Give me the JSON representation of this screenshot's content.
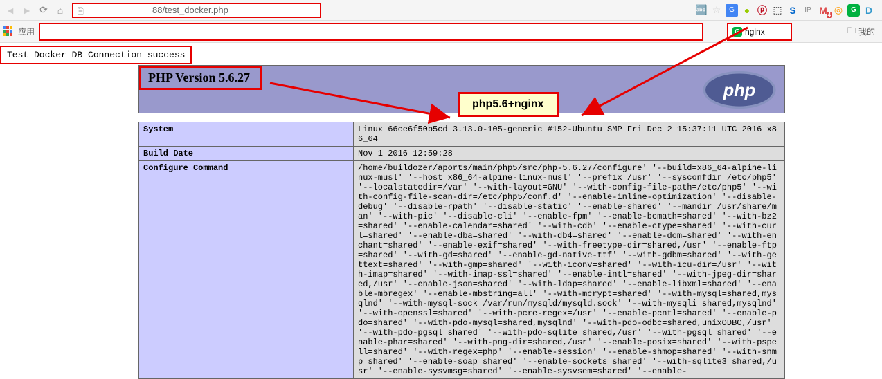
{
  "browser": {
    "url_visible": "88/test_docker.php",
    "apps_label": "应用",
    "other_bookmarks": "我的",
    "toolbar_icons": [
      "translate-icon",
      "star-icon",
      "google-icon",
      "green-dot-icon",
      "pinterest-icon",
      "extension-icon",
      "s-icon",
      "ip-icon",
      "gmail-icon",
      "gmail-badge-4",
      "circle-icon",
      "g-green-icon",
      "d-icon"
    ]
  },
  "callouts": {
    "nginx_label": "nginx",
    "success_message": "Test Docker DB Connection success",
    "annotation": "php5.6+nginx"
  },
  "phpinfo": {
    "version": "PHP Version 5.6.27",
    "rows": [
      {
        "label": "System",
        "value": "Linux 66ce6f50b5cd 3.13.0-105-generic #152-Ubuntu SMP Fri Dec 2 15:37:11 UTC 2016 x86_64"
      },
      {
        "label": "Build Date",
        "value": "Nov 1 2016 12:59:28"
      },
      {
        "label": "Configure Command",
        "value": "/home/buildozer/aports/main/php5/src/php-5.6.27/configure' '--build=x86_64-alpine-linux-musl' '--host=x86_64-alpine-linux-musl' '--prefix=/usr' '--sysconfdir=/etc/php5' '--localstatedir=/var' '--with-layout=GNU' '--with-config-file-path=/etc/php5' '--with-config-file-scan-dir=/etc/php5/conf.d' '--enable-inline-optimization' '--disable-debug' '--disable-rpath' '--disable-static' '--enable-shared' '--mandir=/usr/share/man' '--with-pic' '--disable-cli' '--enable-fpm' '--enable-bcmath=shared' '--with-bz2=shared' '--enable-calendar=shared' '--with-cdb' '--enable-ctype=shared' '--with-curl=shared' '--enable-dba=shared' '--with-db4=shared' '--enable-dom=shared' '--with-enchant=shared' '--enable-exif=shared' '--with-freetype-dir=shared,/usr' '--enable-ftp=shared' '--with-gd=shared' '--enable-gd-native-ttf' '--with-gdbm=shared' '--with-gettext=shared' '--with-gmp=shared' '--with-iconv=shared' '--with-icu-dir=/usr' '--with-imap=shared' '--with-imap-ssl=shared' '--enable-intl=shared' '--with-jpeg-dir=shared,/usr' '--enable-json=shared' '--with-ldap=shared' '--enable-libxml=shared' '--enable-mbregex' '--enable-mbstring=all' '--with-mcrypt=shared' '--with-mysql=shared,mysqlnd' '--with-mysql-sock=/var/run/mysqld/mysqld.sock' '--with-mysqli=shared,mysqlnd' '--with-openssl=shared' '--with-pcre-regex=/usr' '--enable-pcntl=shared' '--enable-pdo=shared' '--with-pdo-mysql=shared,mysqlnd' '--with-pdo-odbc=shared,unixODBC,/usr' '--with-pdo-pgsql=shared' '--with-pdo-sqlite=shared,/usr' '--with-pgsql=shared' '--enable-phar=shared' '--with-png-dir=shared,/usr' '--enable-posix=shared' '--with-pspell=shared' '--with-regex=php' '--enable-session' '--enable-shmop=shared' '--with-snmp=shared' '--enable-soap=shared' '--enable-sockets=shared' '--with-sqlite3=shared,/usr' '--enable-sysvmsg=shared' '--enable-sysvsem=shared' '--enable-"
      }
    ]
  }
}
